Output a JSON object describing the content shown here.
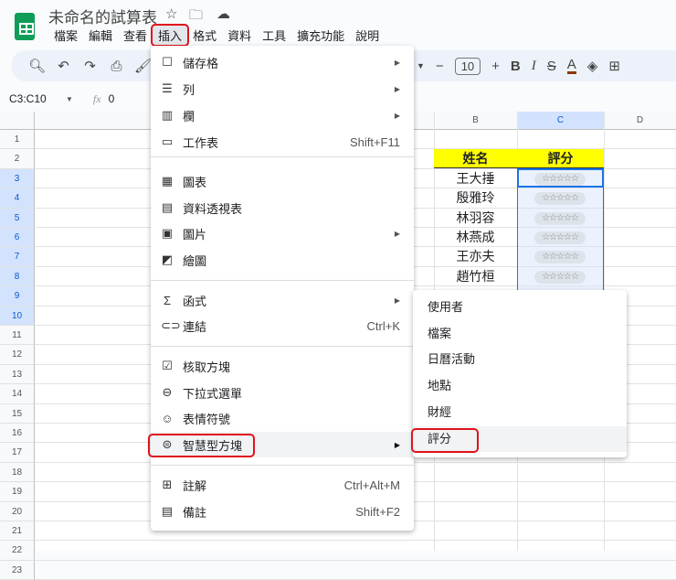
{
  "app": {
    "title": "未命名的試算表",
    "icons": [
      "star-icon",
      "move-to-folder-icon",
      "cloud-saved-icon"
    ]
  },
  "menubar": [
    "檔案",
    "編輯",
    "查看",
    "插入",
    "格式",
    "資料",
    "工具",
    "擴充功能",
    "說明"
  ],
  "toolbar": {
    "font_size": "10",
    "minus": "−",
    "plus": "+",
    "bold": "B",
    "italic": "I",
    "strike": "S",
    "text_color": "A"
  },
  "formula": {
    "name_box": "C3:C10",
    "fx": "fx",
    "value": "0"
  },
  "columns": [
    "B",
    "C",
    "D"
  ],
  "rows": [
    "1",
    "2",
    "3",
    "4",
    "5",
    "6",
    "7",
    "8",
    "9",
    "10",
    "11",
    "12",
    "13",
    "14",
    "15",
    "16",
    "17",
    "18",
    "19",
    "20",
    "21",
    "22",
    "23"
  ],
  "table": {
    "header_name": "姓名",
    "header_score": "評分",
    "names": [
      "王大捶",
      "殷雅玲",
      "林羽容",
      "林燕成",
      "王亦夫",
      "趙竹桓"
    ],
    "stars": "☆☆☆☆☆"
  },
  "insert_menu": [
    {
      "label": "儲存格",
      "icon": "cell-icon",
      "arrow": true
    },
    {
      "label": "列",
      "icon": "row-icon",
      "arrow": true
    },
    {
      "label": "欄",
      "icon": "column-icon",
      "arrow": true
    },
    {
      "label": "工作表",
      "icon": "sheet-icon",
      "shortcut": "Shift+F11"
    },
    {
      "label": "圖表",
      "icon": "chart-icon"
    },
    {
      "label": "資料透視表",
      "icon": "pivot-table-icon"
    },
    {
      "label": "圖片",
      "icon": "image-icon",
      "arrow": true
    },
    {
      "label": "繪圖",
      "icon": "drawing-icon"
    },
    {
      "label": "函式",
      "icon": "sigma-icon",
      "arrow": true
    },
    {
      "label": "連結",
      "icon": "link-icon",
      "shortcut": "Ctrl+K"
    },
    {
      "label": "核取方塊",
      "icon": "checkbox-icon"
    },
    {
      "label": "下拉式選單",
      "icon": "dropdown-icon"
    },
    {
      "label": "表情符號",
      "icon": "emoji-icon"
    },
    {
      "label": "智慧型方塊",
      "icon": "smart-chip-icon",
      "arrow": true
    },
    {
      "label": "註解",
      "icon": "comment-icon",
      "shortcut": "Ctrl+Alt+M"
    },
    {
      "label": "備註",
      "icon": "note-icon",
      "shortcut": "Shift+F2"
    }
  ],
  "smart_chip_submenu": [
    "使用者",
    "檔案",
    "日曆活動",
    "地點",
    "財經",
    "評分"
  ]
}
